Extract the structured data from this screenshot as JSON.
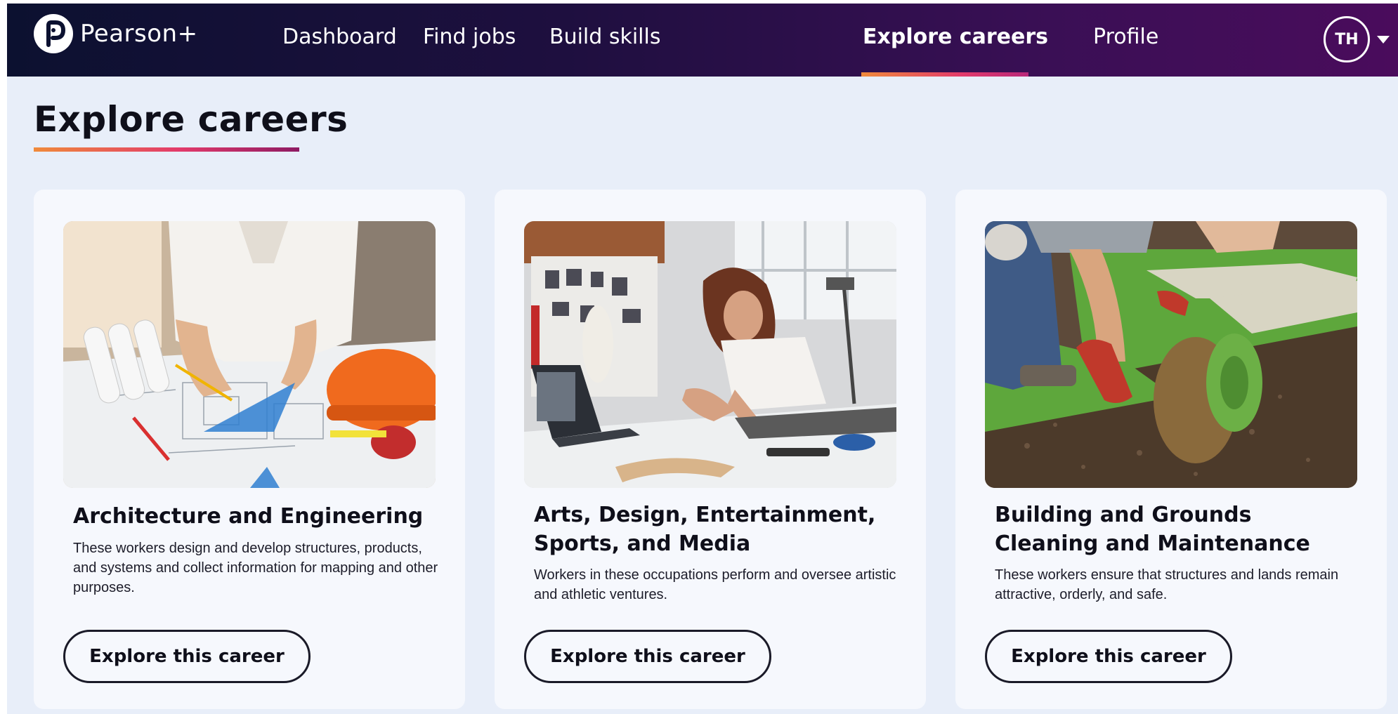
{
  "header": {
    "brand": "Pearson+",
    "nav": [
      {
        "label": "Dashboard",
        "active": false
      },
      {
        "label": "Find jobs",
        "active": false
      },
      {
        "label": "Build skills",
        "active": false
      },
      {
        "label": "Explore careers",
        "active": true
      },
      {
        "label": "Profile",
        "active": false
      }
    ],
    "avatar_initials": "TH"
  },
  "page": {
    "title": "Explore careers"
  },
  "cards": [
    {
      "title": "Architecture and Engineering",
      "description": "These workers design and develop structures, products, and systems and collect information for mapping and other purposes.",
      "button_label": "Explore this career",
      "image": "architect-blueprints-photo"
    },
    {
      "title": "Arts, Design, Entertainment, Sports, and Media",
      "description": "Workers in these occupations perform and oversee artistic and athletic ventures.",
      "button_label": "Explore this career",
      "image": "designer-studio-photo"
    },
    {
      "title": "Building and Grounds Cleaning and Maintenance",
      "description": "These workers ensure that structures and lands remain attractive, orderly, and safe.",
      "button_label": "Explore this career",
      "image": "laying-sod-photo"
    }
  ],
  "colors": {
    "nav_gradient_start": "#0c1130",
    "nav_gradient_end": "#4a0c5c",
    "accent_orange": "#f08a3b",
    "accent_pink": "#e23a6b",
    "page_background": "#e8eef9",
    "card_background": "#f6f8fd"
  }
}
